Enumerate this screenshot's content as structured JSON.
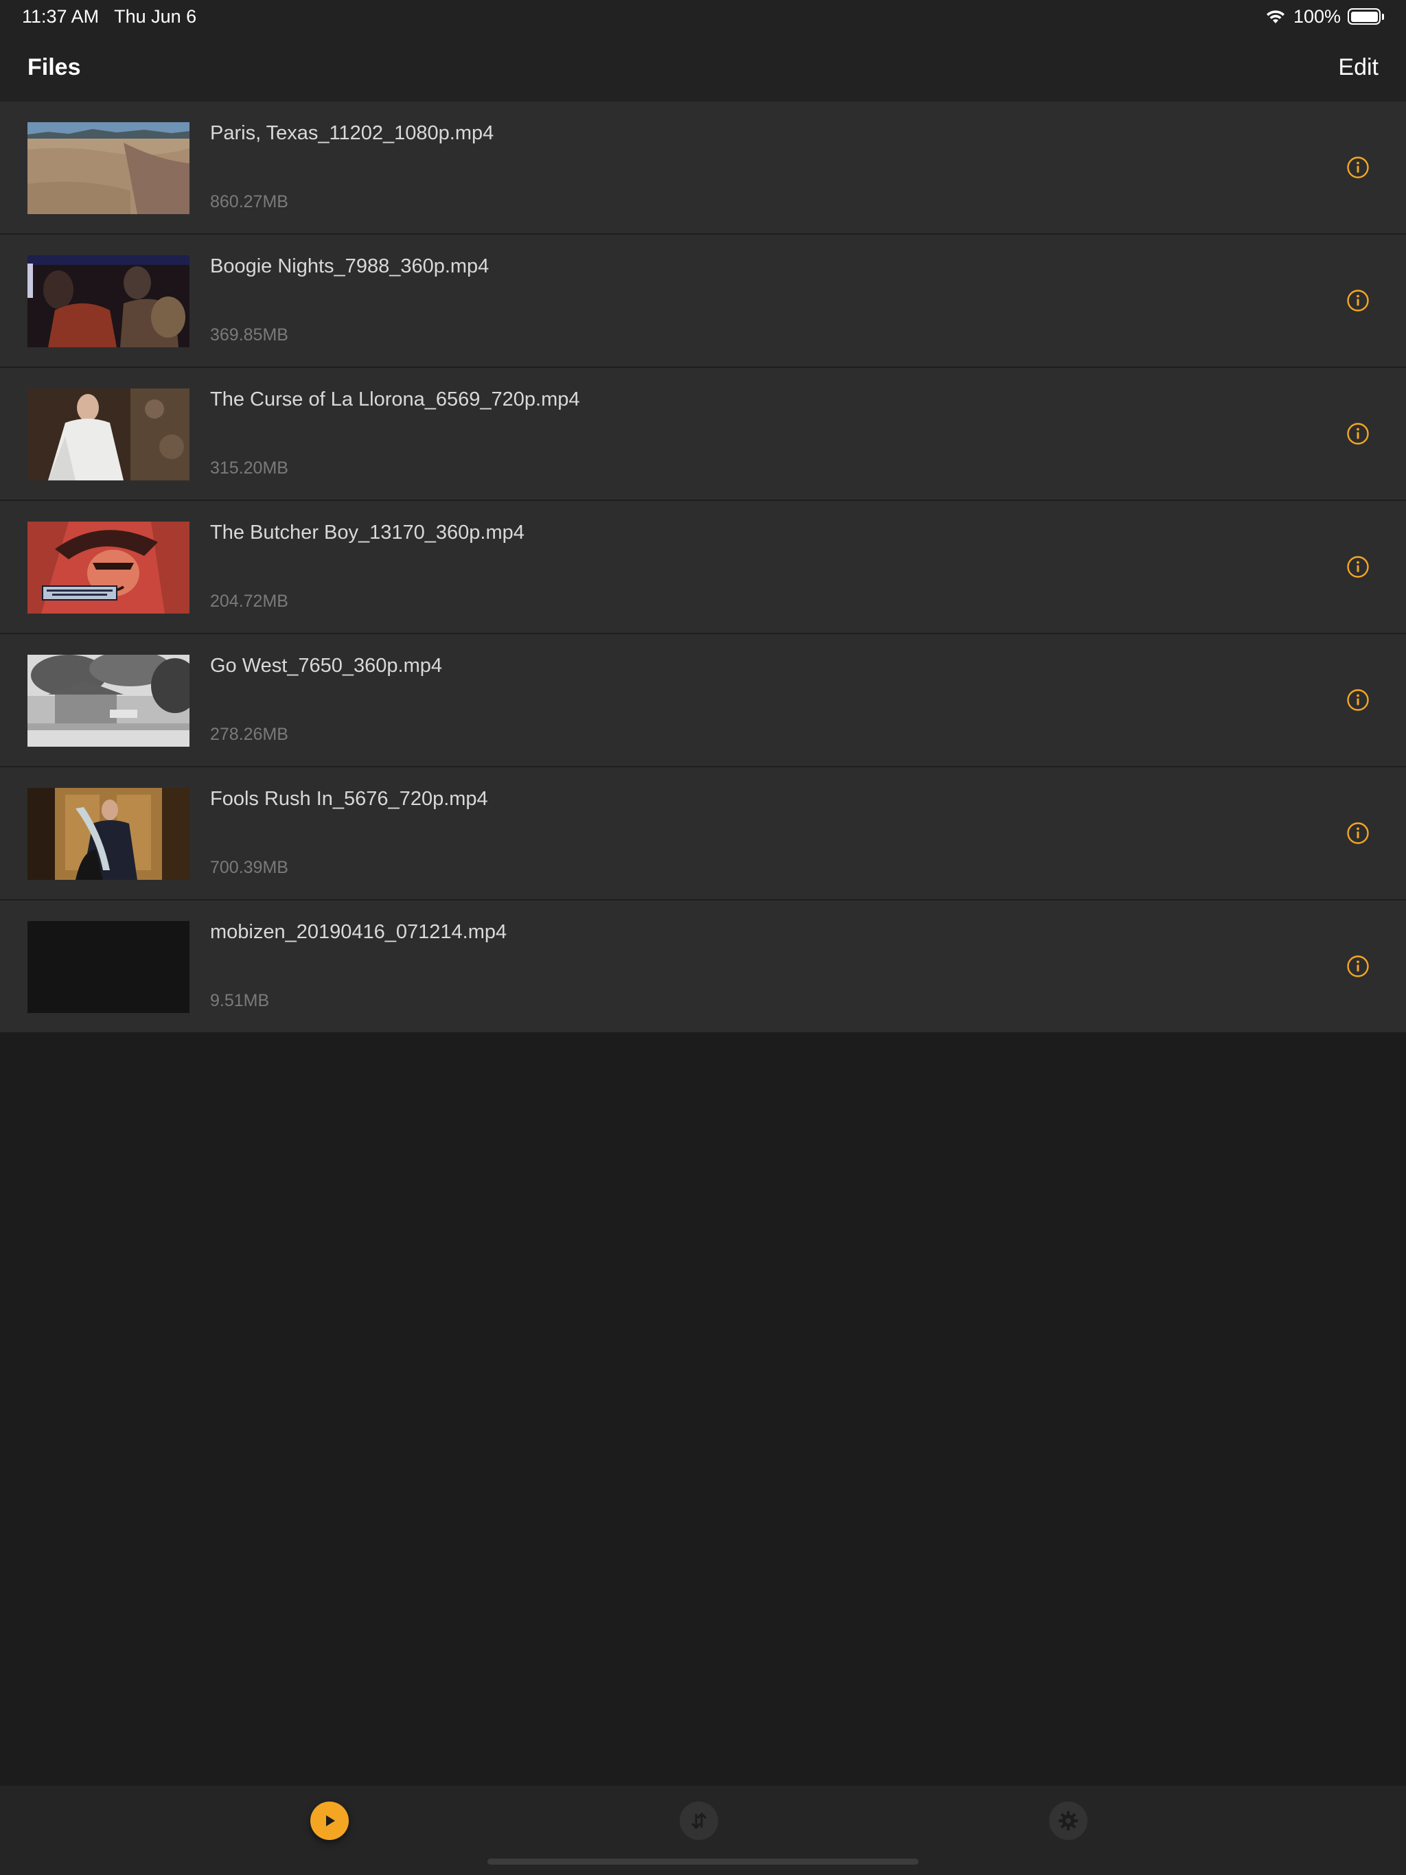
{
  "status_bar": {
    "time": "11:37 AM",
    "date": "Thu Jun 6",
    "battery": "100%",
    "battery_level": 1.0
  },
  "nav": {
    "title": "Files",
    "edit_label": "Edit"
  },
  "files": [
    {
      "title": "Paris, Texas_11202_1080p.mp4",
      "size": "860.27MB"
    },
    {
      "title": "Boogie Nights_7988_360p.mp4",
      "size": "369.85MB"
    },
    {
      "title": "The Curse of La Llorona_6569_720p.mp4",
      "size": "315.20MB"
    },
    {
      "title": "The Butcher Boy_13170_360p.mp4",
      "size": "204.72MB"
    },
    {
      "title": "Go West_7650_360p.mp4",
      "size": "278.26MB"
    },
    {
      "title": "Fools Rush In_5676_720p.mp4",
      "size": "700.39MB"
    },
    {
      "title": "mobizen_20190416_071214.mp4",
      "size": "9.51MB"
    }
  ],
  "tabs": [
    {
      "icon": "play-icon",
      "selected": true
    },
    {
      "icon": "transfer-icon",
      "selected": false
    },
    {
      "icon": "gear-icon",
      "selected": false
    }
  ],
  "colors": {
    "accent": "#f4a623",
    "background": "#1c1c1c",
    "row_background": "#2d2d2d",
    "bar_background": "#222222"
  }
}
